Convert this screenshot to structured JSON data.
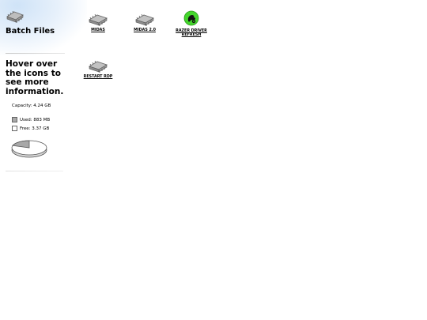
{
  "folder": {
    "title": "Batch Files",
    "icon": "folder-chip-icon"
  },
  "info": {
    "hover_text": "Hover over the icons to see more information.",
    "capacity": "Capacity: 4.24 GB",
    "used": "Used: 883 MB",
    "free": "Free: 3.37 GB",
    "used_fraction": 0.2,
    "colors": {
      "used": "#a8a8a8",
      "free": "#ffffff"
    }
  },
  "files": [
    {
      "label": "MIDAS",
      "icon": "chip-icon"
    },
    {
      "label": "MIDAS 2.0",
      "icon": "chip-icon"
    },
    {
      "label": "RAZER DRIVER REFRESH",
      "icon": "razer-logo-icon",
      "color": "#44d62c"
    },
    {
      "label": "RESTART RDP",
      "icon": "chip-icon"
    }
  ]
}
